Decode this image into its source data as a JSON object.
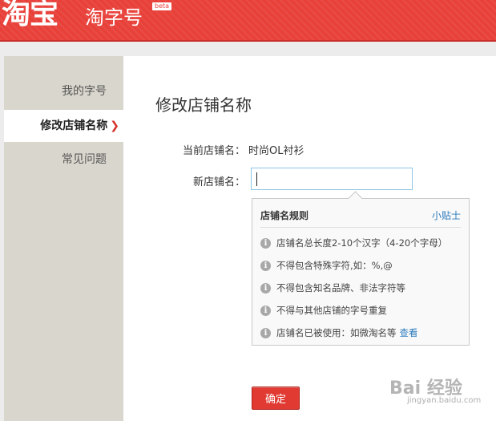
{
  "header": {
    "logo_text": "淘宝",
    "product_name": "淘字号",
    "beta_label": "beta"
  },
  "sidebar": {
    "items": [
      {
        "label": "我的字号",
        "active": false
      },
      {
        "label": "修改店铺名称",
        "active": true
      },
      {
        "label": "常见问题",
        "active": false
      }
    ],
    "active_arrow": "❯"
  },
  "main": {
    "title": "修改店铺名称",
    "current_name_label": "当前店铺名：",
    "current_name_value": "时尚OL衬衫",
    "new_name_label": "新店铺名：",
    "new_name_value": ""
  },
  "rules": {
    "title": "店铺名规则",
    "tip_link": "小贴士",
    "info_icon_glyph": "i",
    "items": [
      "店铺名总长度2-10个汉字（4-20个字母）",
      "不得包含特殊字符,如：%,@",
      "不得包含知名品牌、非法字符等",
      "不得与其他店铺的字号重复",
      "店铺名已被使用：如微淘名等"
    ],
    "view_link": "查看"
  },
  "actions": {
    "confirm_label": "确定"
  },
  "watermark": {
    "text": "Bai 经验",
    "sub": "jingyan.baidu.com"
  },
  "colors": {
    "header_red": "#e8413a",
    "sidebar_bg": "#d9d6cd",
    "link_blue": "#2b7bbd",
    "button_red": "#e03a32"
  }
}
